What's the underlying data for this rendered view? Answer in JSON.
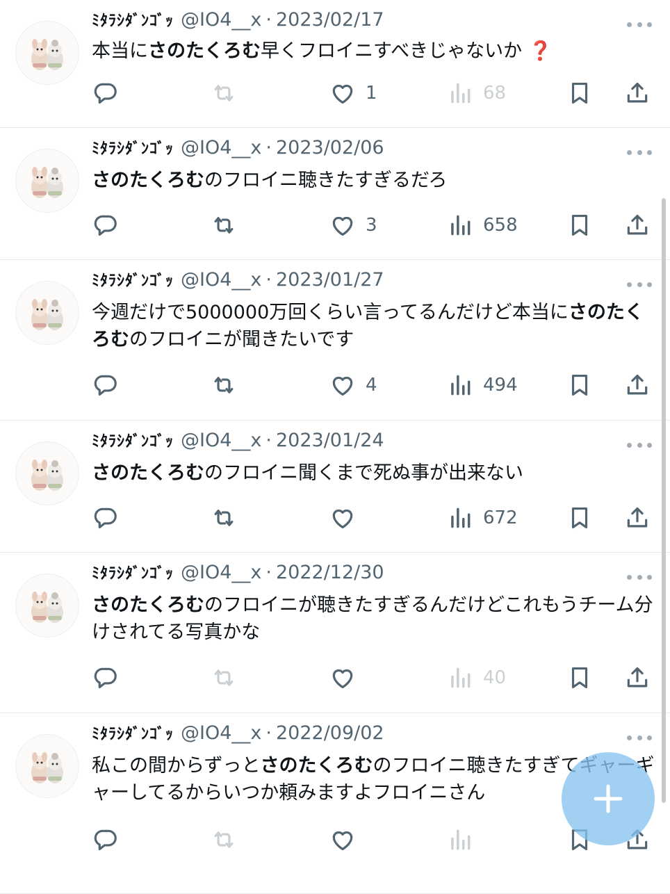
{
  "tweets": [
    {
      "name": "ﾐﾀﾗｼﾀﾞﾝｺﾞｯ",
      "handle": "@IO4__x",
      "date": "2023/02/17",
      "text": [
        {
          "t": "本当に",
          "b": false
        },
        {
          "t": "さのたくろむ",
          "b": true
        },
        {
          "t": "早くフロイニすべきじゃないか",
          "b": false
        },
        {
          "t": " ❓",
          "b": false,
          "q": true
        }
      ],
      "likes": "1",
      "views": "68",
      "retweet_dim": true,
      "views_dim": true
    },
    {
      "name": "ﾐﾀﾗｼﾀﾞﾝｺﾞｯ",
      "handle": "@IO4__x",
      "date": "2023/02/06",
      "text": [
        {
          "t": "さのたくろむ",
          "b": true
        },
        {
          "t": "のフロイニ聴きたすぎるだろ",
          "b": false
        }
      ],
      "likes": "3",
      "views": "658",
      "retweet_dim": false,
      "views_dim": false
    },
    {
      "name": "ﾐﾀﾗｼﾀﾞﾝｺﾞｯ",
      "handle": "@IO4__x",
      "date": "2023/01/27",
      "text": [
        {
          "t": "今週だけで5000000万回くらい言ってるんだけど本当に",
          "b": false
        },
        {
          "t": "さのたくろむ",
          "b": true
        },
        {
          "t": "のフロイニが聞きたいです",
          "b": false
        }
      ],
      "likes": "4",
      "views": "494",
      "retweet_dim": false,
      "views_dim": false
    },
    {
      "name": "ﾐﾀﾗｼﾀﾞﾝｺﾞｯ",
      "handle": "@IO4__x",
      "date": "2023/01/24",
      "text": [
        {
          "t": "さのたくろむ",
          "b": true
        },
        {
          "t": "のフロイニ聞くまで死ぬ事が出来ない",
          "b": false
        }
      ],
      "likes": "",
      "views": "672",
      "retweet_dim": false,
      "views_dim": false
    },
    {
      "name": "ﾐﾀﾗｼﾀﾞﾝｺﾞｯ",
      "handle": "@IO4__x",
      "date": "2022/12/30",
      "text": [
        {
          "t": "さのたくろむ",
          "b": true
        },
        {
          "t": "のフロイニが聴きたすぎるんだけどこれもうチーム分けされてる写真かな",
          "b": false
        }
      ],
      "likes": "",
      "views": "40",
      "retweet_dim": true,
      "views_dim": true
    },
    {
      "name": "ﾐﾀﾗｼﾀﾞﾝｺﾞｯ",
      "handle": "@IO4__x",
      "date": "2022/09/02",
      "text": [
        {
          "t": "私この間からずっと",
          "b": false
        },
        {
          "t": "さのたくろむ",
          "b": true
        },
        {
          "t": "のフロイニ聴きたすぎてギャーギャーしてるからいつか頼みますよフロイニさん",
          "b": false
        }
      ],
      "likes": "",
      "views": "",
      "retweet_dim": true,
      "views_dim": true
    }
  ],
  "icons": {
    "reply": "reply-icon",
    "retweet": "retweet-icon",
    "like": "heart-icon",
    "views": "views-icon",
    "bookmark": "bookmark-icon",
    "share": "share-icon",
    "compose": "plus-icon"
  },
  "colors": {
    "text": "#0f1419",
    "secondary": "#536471",
    "accent": "#1d9bf0",
    "fab": "#87c3f0"
  }
}
